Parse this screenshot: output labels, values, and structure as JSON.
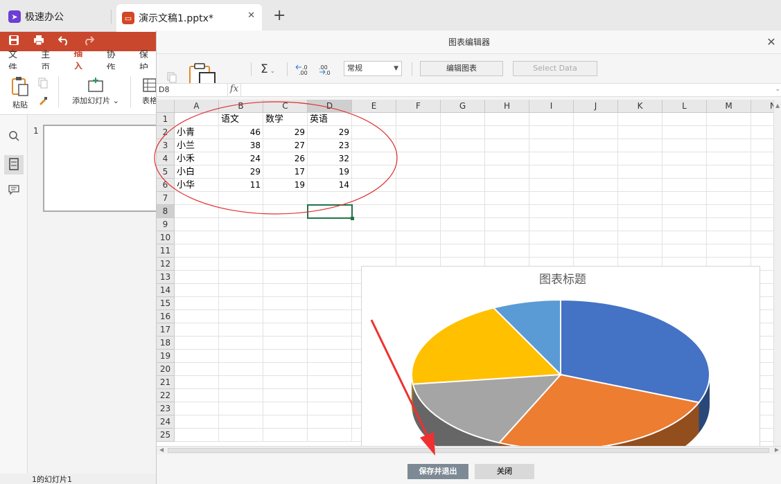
{
  "tabs": {
    "home_label": "极速办公",
    "doc_label": "演示文稿1.pptx*",
    "close_glyph": "✕",
    "add_glyph": "+"
  },
  "ribbon": {
    "tabs": [
      "文件",
      "主页",
      "插入",
      "协作",
      "保护"
    ],
    "active_tab": "插入",
    "paste_label": "粘贴",
    "add_slide_label": "添加幻灯片",
    "table_label": "表格"
  },
  "slides": {
    "slide_number": "1",
    "status_text": "1的幻灯片1"
  },
  "dialog": {
    "title": "图表编辑器",
    "close_glyph": "✕",
    "edit_chart_label": "编辑图表",
    "select_data_label": "Select Data",
    "number_format": "常规",
    "cell_ref": "D8",
    "fx_label": "fx",
    "save_exit_label": "保存并退出",
    "close_label": "关闭"
  },
  "sheet": {
    "columns": [
      "A",
      "B",
      "C",
      "D",
      "E",
      "F",
      "G",
      "H",
      "I",
      "J",
      "K",
      "L",
      "M",
      "N"
    ],
    "rows": [
      "1",
      "2",
      "3",
      "4",
      "5",
      "6",
      "7",
      "8",
      "9",
      "10",
      "11",
      "12",
      "13",
      "14",
      "15",
      "16",
      "17",
      "18",
      "19",
      "20",
      "21",
      "22",
      "23",
      "24",
      "25"
    ],
    "header_row": [
      "",
      "语文",
      "数学",
      "英语"
    ],
    "data": [
      [
        "小青",
        "46",
        "29",
        "29"
      ],
      [
        "小兰",
        "38",
        "27",
        "23"
      ],
      [
        "小禾",
        "24",
        "26",
        "32"
      ],
      [
        "小白",
        "29",
        "17",
        "19"
      ],
      [
        "小华",
        "11",
        "19",
        "14"
      ]
    ],
    "selected_column": "D",
    "selected_row": "8"
  },
  "chart_data": {
    "type": "pie",
    "title": "图表标题",
    "categories": [
      "小青",
      "小兰",
      "小禾",
      "小白",
      "小华"
    ],
    "values": [
      46,
      38,
      24,
      29,
      11
    ],
    "colors": [
      "#4472c4",
      "#ed7d31",
      "#a5a5a5",
      "#ffc000",
      "#5b9bd5"
    ],
    "legend_position": "bottom",
    "legend_square_color": "#70ad47"
  },
  "icons": {
    "sigma": "Σ",
    "dec_inc": "←.0 .00",
    "dec_dec": ".00 →.0"
  },
  "annotation_colors": {
    "ellipse": "#e03030",
    "arrow": "#f03030"
  }
}
